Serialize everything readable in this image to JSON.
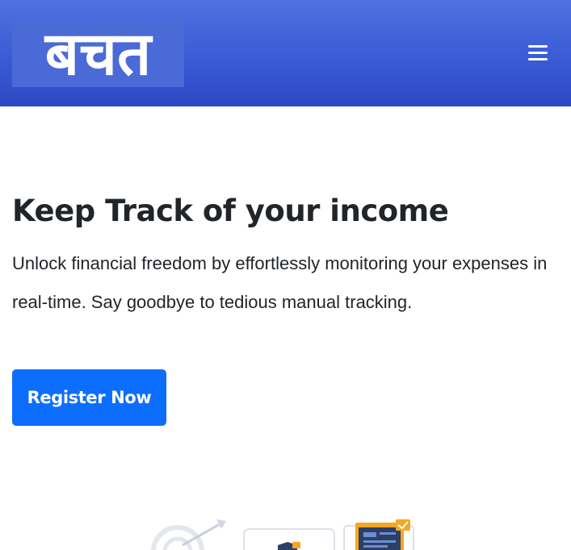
{
  "navbar": {
    "logo_text": "बचत",
    "menu_icon": "hamburger-icon"
  },
  "hero": {
    "title": "Keep Track of your income",
    "description": "Unlock financial freedom by effortlessly monitoring your expenses in real-time. Say goodbye to tedious manual tracking.",
    "cta_label": "Register Now"
  },
  "illustration": {
    "icons": [
      "target-icon",
      "shield-icon",
      "dashboard-card-icon"
    ]
  },
  "colors": {
    "navbar": "#3a5bd4",
    "primary_button": "#0d6efd",
    "text": "#212529",
    "accent": "#f5a623"
  }
}
